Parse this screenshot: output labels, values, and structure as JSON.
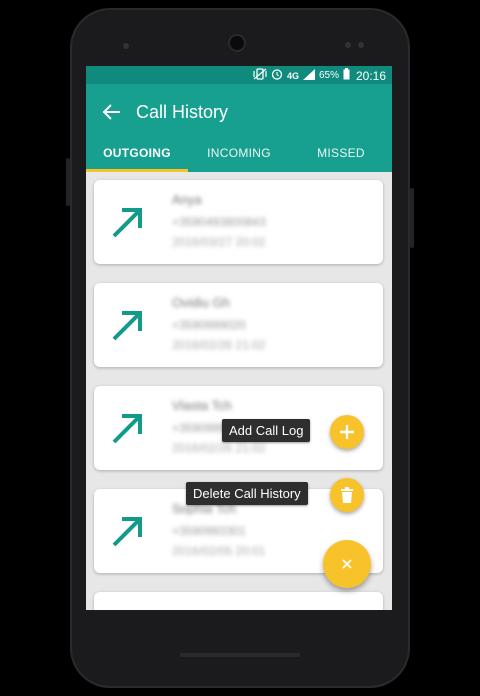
{
  "status_bar": {
    "network": "4G",
    "battery": "65%",
    "time": "20:16"
  },
  "app_bar": {
    "title": "Call History",
    "back_icon": "arrow-back-icon"
  },
  "tabs": [
    {
      "label": "OUTGOING",
      "active": true
    },
    {
      "label": "INCOMING",
      "active": false
    },
    {
      "label": "MISSED",
      "active": false
    }
  ],
  "calls": [
    {
      "type": "outgoing",
      "name": "Anya",
      "number": "+3590493800843",
      "date": "2016/03/27 20:02"
    },
    {
      "type": "outgoing",
      "name": "Ovidiu Gh",
      "number": "+3590999020",
      "date": "2016/02/26 21:02"
    },
    {
      "type": "outgoing",
      "name": "Vlasta Tch",
      "number": "+3590999020",
      "date": "2016/02/26 21:02"
    },
    {
      "type": "outgoing",
      "name": "Sophia Tch",
      "number": "+3590993301",
      "date": "2016/02/05 20:01"
    }
  ],
  "fab_menu": {
    "add_label": "Add Call Log",
    "delete_label": "Delete Call History",
    "main_icon": "close-icon"
  },
  "colors": {
    "primary": "#17a08f",
    "primary_dark": "#0f8a7c",
    "accent": "#f8c22b",
    "arrow": "#129a8a"
  }
}
